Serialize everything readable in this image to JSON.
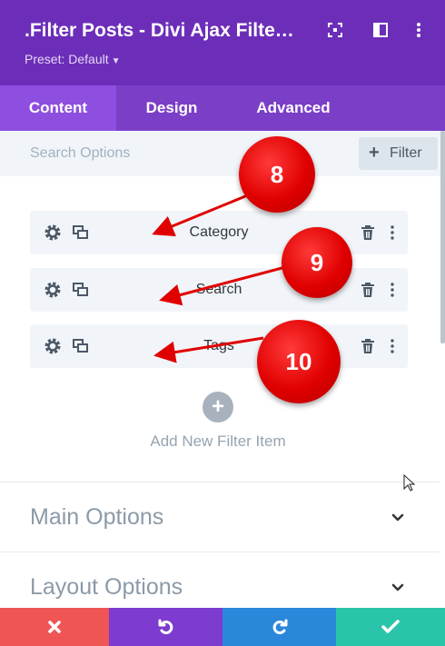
{
  "header": {
    "title": ".Filter Posts - Divi Ajax Filte…",
    "preset_label": "Preset: Default",
    "bg_color": "#6c2eb9",
    "icons": [
      "focus-icon",
      "sidebar-toggle-icon",
      "more-vertical-icon"
    ]
  },
  "tabs": [
    {
      "label": "Content",
      "active": true
    },
    {
      "label": "Design",
      "active": false
    },
    {
      "label": "Advanced",
      "active": false
    }
  ],
  "search": {
    "label": "Search Options",
    "filter_button": "Filter"
  },
  "filter_items": [
    {
      "label": "Category"
    },
    {
      "label": "Search"
    },
    {
      "label": "Tags"
    }
  ],
  "add_item": {
    "label": "Add New Filter Item"
  },
  "sections": [
    {
      "title": "Main Options"
    },
    {
      "title": "Layout Options"
    }
  ],
  "annotations": [
    "8",
    "9",
    "10"
  ],
  "footer": {
    "colors": {
      "discard": "#ef5555",
      "undo": "#7d3bcf",
      "redo": "#2b87da",
      "save": "#29c4a9"
    }
  }
}
